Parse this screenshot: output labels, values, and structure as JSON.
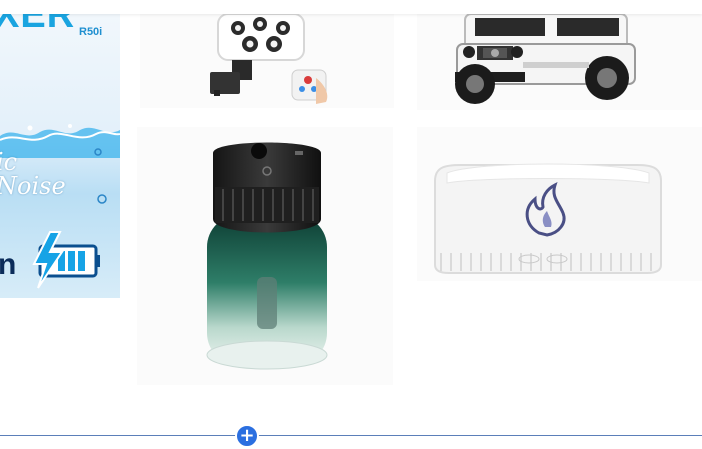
{
  "banner": {
    "brand": "XER",
    "model": "R50i",
    "script_line_1": "ic",
    "script_line_2": "Noise",
    "bottom_text": "n"
  },
  "products": [
    {
      "name": "solar-security-camera"
    },
    {
      "name": "toy-suv-car"
    },
    {
      "name": "mini-humidifier"
    },
    {
      "name": "flame-aroma-diffuser"
    }
  ],
  "add_section": {
    "label": "+",
    "color": "#2b6fe0"
  }
}
